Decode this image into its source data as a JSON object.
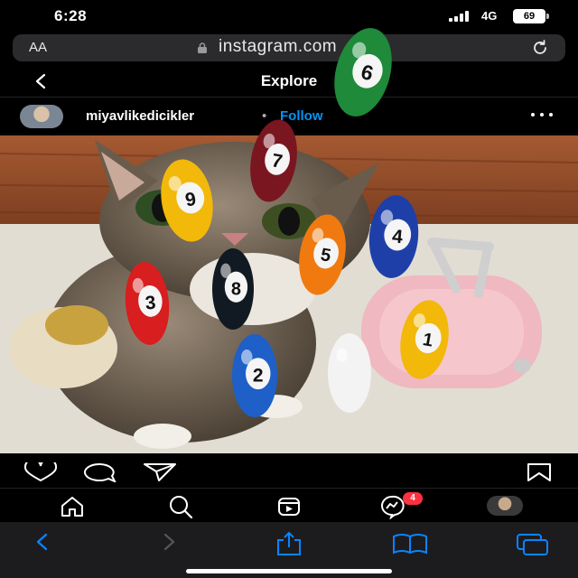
{
  "status_bar": {
    "time": "6:28",
    "network": "4G",
    "battery": "69"
  },
  "url_bar": {
    "text_size_label": "AA",
    "url": "instagram.com"
  },
  "header": {
    "title": "Explore"
  },
  "post": {
    "username": "miyavlikedicikler",
    "separator": "•",
    "follow_label": "Follow",
    "image_description_icons": [
      "cat-photo",
      "billiard-balls",
      "pink-suitcase"
    ]
  },
  "billiard_balls": [
    {
      "number": "6",
      "color": "#1e8a3a"
    },
    {
      "number": "7",
      "color": "#7a1620"
    },
    {
      "number": "9",
      "color": "#f2b80a"
    },
    {
      "number": "4",
      "color": "#1f3fa8"
    },
    {
      "number": "5",
      "color": "#f07a10"
    },
    {
      "number": "8",
      "color": "#111a22"
    },
    {
      "number": "3",
      "color": "#d81e1e"
    },
    {
      "number": "2",
      "color": "#1e5fc8"
    },
    {
      "number": "1",
      "color": "#f2b80a"
    },
    {
      "number": "",
      "color": "#f3f3f3"
    }
  ],
  "ig_nav": {
    "notification_count": "4"
  },
  "colors": {
    "accent": "#0095f6",
    "safari_blue": "#0a84ff",
    "badge": "#ff3040"
  }
}
